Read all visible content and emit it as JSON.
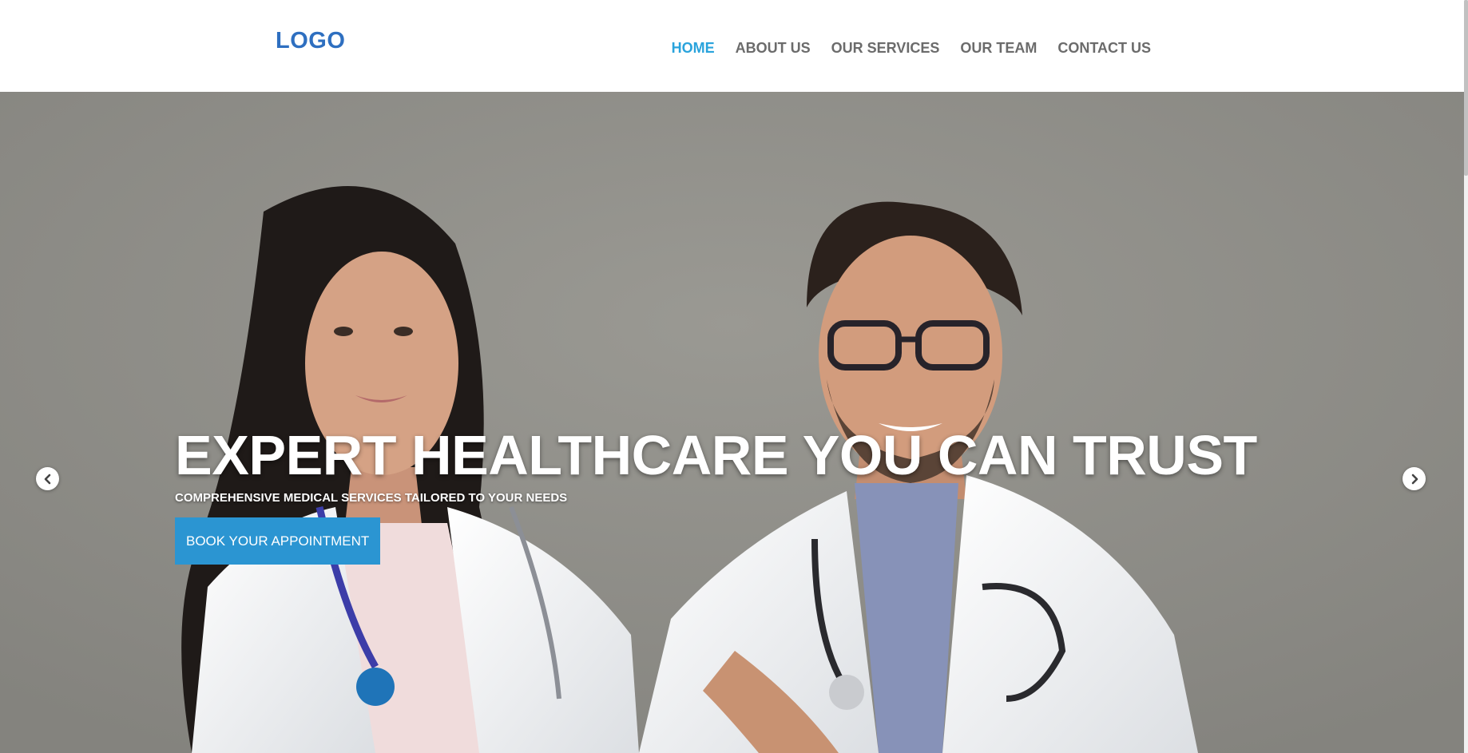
{
  "header": {
    "logo_text": "LOGO",
    "nav": [
      {
        "label": "HOME",
        "active": true
      },
      {
        "label": "ABOUT US",
        "active": false
      },
      {
        "label": "OUR SERVICES",
        "active": false
      },
      {
        "label": "OUR TEAM",
        "active": false
      },
      {
        "label": "CONTACT US",
        "active": false
      }
    ]
  },
  "hero": {
    "title": "EXPERT HEALTHCARE YOU CAN TRUST",
    "subtitle": "COMPREHENSIVE MEDICAL SERVICES TAILORED TO YOUR NEEDS",
    "cta_label": "BOOK YOUR APPOINTMENT",
    "prev_icon": "chevron-left-icon",
    "next_icon": "chevron-right-icon",
    "background_image": "two smiling doctors in white coats with stethoscopes"
  },
  "colors": {
    "logo": "#2e6fc0",
    "nav_active": "#29a3dc",
    "nav_default": "#6b6b6b",
    "cta_bg": "#2b95d2",
    "hero_bg": "#8b8a85"
  }
}
